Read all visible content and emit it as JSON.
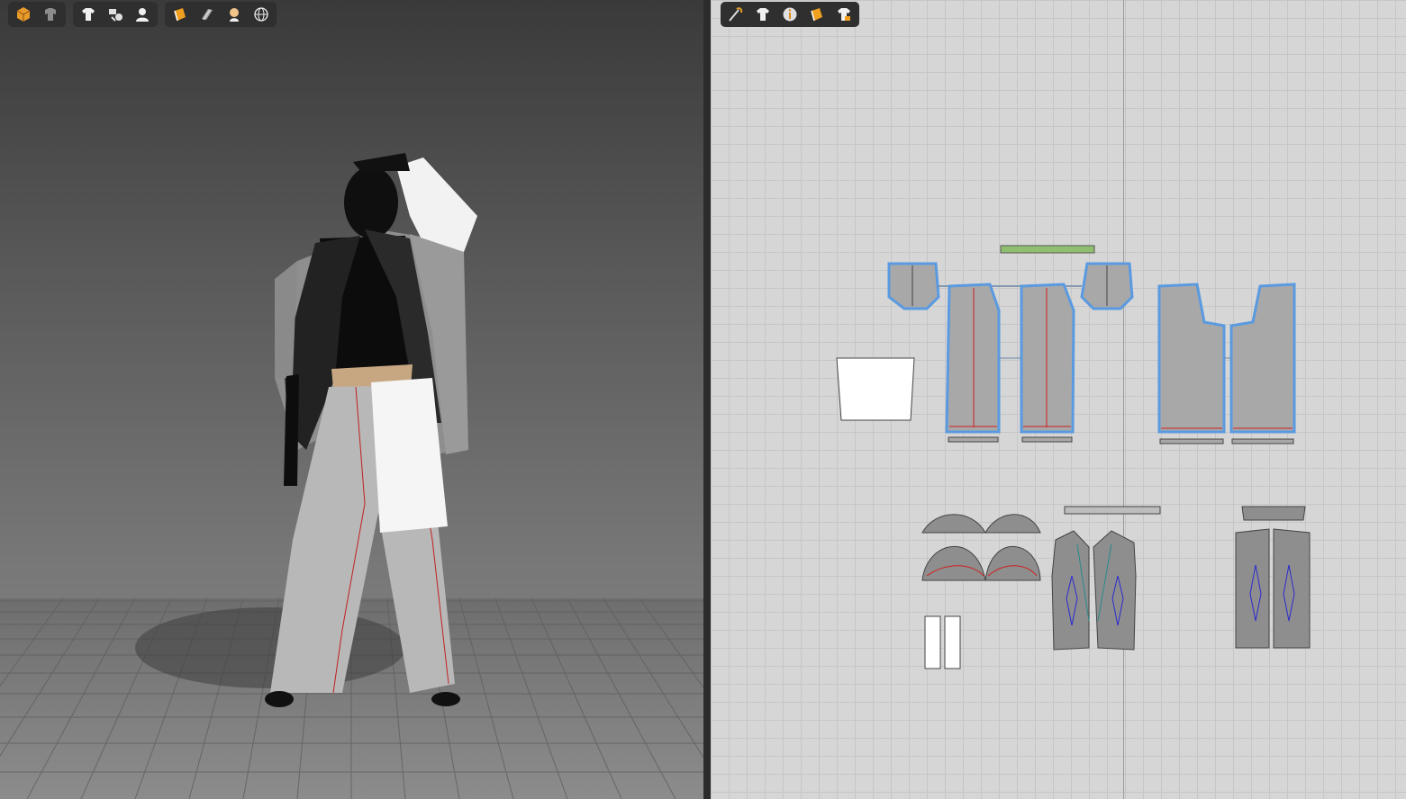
{
  "viewport_3d": {
    "toolbar_groups": [
      {
        "icons": [
          "box-render-icon",
          "avatar-garment-icon"
        ]
      },
      {
        "icons": [
          "tshirt-icon",
          "fabric-swatch-icon",
          "avatar-icon"
        ]
      },
      {
        "icons": [
          "texture-icon",
          "thickness-icon",
          "skin-icon",
          "globe-icon"
        ]
      }
    ]
  },
  "viewport_2d": {
    "toolbar_icons": [
      "pattern-tool-icon",
      "tshirt-icon",
      "info-icon",
      "texture-icon",
      "tshirt-lock-icon"
    ]
  },
  "colors": {
    "outline_selected": "#5a9ae0",
    "pattern_fill": "#a8a8a8",
    "seam": "#d02020",
    "highlight_strip": "#8fbf6f"
  }
}
